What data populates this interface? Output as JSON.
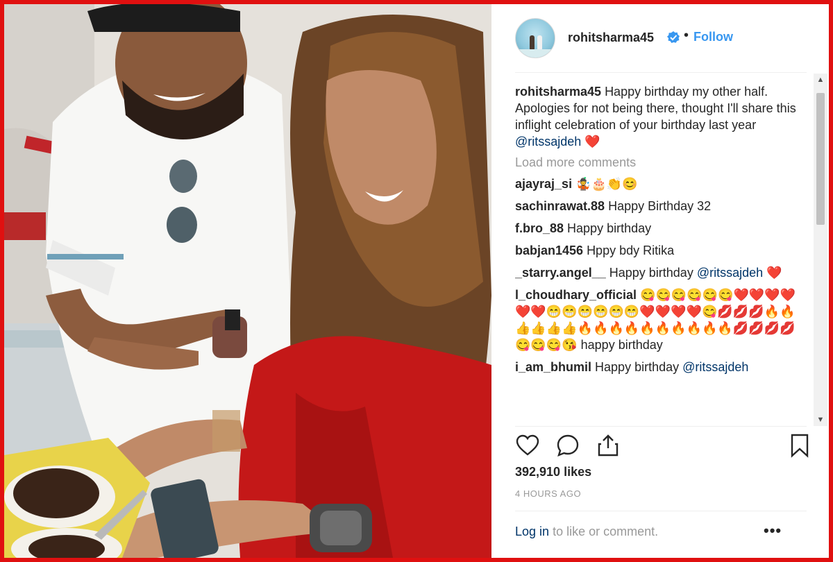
{
  "post": {
    "username": "rohitsharma45",
    "follow_label": "Follow",
    "separator": "•",
    "caption": {
      "user": "rohitsharma45",
      "text": "Happy birthday my other half. Apologies for not being there, thought I'll share this inflight celebration of your birthday last year",
      "mention": "@ritssajdeh",
      "emoji": "❤️"
    },
    "load_more": "Load more comments",
    "comments": [
      {
        "user": "ajayraj_si",
        "text": "🤹🎂👏😊",
        "mention": ""
      },
      {
        "user": "sachinrawat.88",
        "text": "Happy Birthday 32",
        "mention": ""
      },
      {
        "user": "f.bro_88",
        "text": "Happy birthday",
        "mention": ""
      },
      {
        "user": "babjan1456",
        "text": "Hppy bdy Ritika",
        "mention": ""
      },
      {
        "user": "_starry.angel__",
        "text": "Happy birthday",
        "mention": "@ritssajdeh",
        "after": "❤️"
      },
      {
        "user": "l_choudhary_official",
        "text": "😋😋😋😋😋😋❤️❤️❤️❤️❤️❤️😁😁😁😁😁😁❤️❤️❤️❤️😋💋💋💋🔥🔥👍👍👍👍🔥🔥🔥🔥🔥🔥🔥🔥🔥🔥💋💋💋💋😋😋😋😘 happy birthday",
        "mention": ""
      },
      {
        "user": "i_am_bhumil",
        "text": "Happy birthday",
        "mention": "@ritssajdeh"
      }
    ],
    "likes": "392,910 likes",
    "time_ago": "4 HOURS AGO",
    "login_link": "Log in",
    "login_text": "to like or comment.",
    "more_label": "•••"
  },
  "icons": {
    "like": "heart-outline-icon",
    "comment": "speech-bubble-icon",
    "share": "share-icon",
    "save": "bookmark-icon",
    "verified": "verified-badge-icon"
  },
  "colors": {
    "frame": "#e01010",
    "link_blue": "#3897f0",
    "mention": "#003569",
    "muted": "#999999",
    "text": "#262626"
  }
}
